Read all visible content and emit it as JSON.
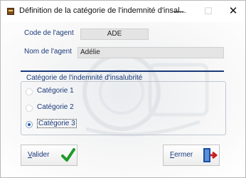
{
  "window": {
    "title": "Définition de la catégorie de l'indemnité d'insal...",
    "minimize": "—",
    "maximize": "☐",
    "close": "✕"
  },
  "form": {
    "code_label": "Code de l'agent",
    "code_value": "ADE",
    "nom_label": "Nom de l'agent",
    "nom_value": "Adélie",
    "group_title": "Catégorie de l'indemnité d'insalubrité",
    "options": [
      {
        "label": "Catégorie 1",
        "selected": false
      },
      {
        "label": "Catégorie 2",
        "selected": false
      },
      {
        "label": "Catégorie 3",
        "selected": true
      }
    ]
  },
  "buttons": {
    "valider_accel": "V",
    "valider_rest": "alider",
    "fermer_accel": "F",
    "fermer_rest": "ermer"
  },
  "colors": {
    "label_blue": "#1a3a7a",
    "check_green": "#1f9a2a",
    "door_red": "#c81e1e"
  }
}
